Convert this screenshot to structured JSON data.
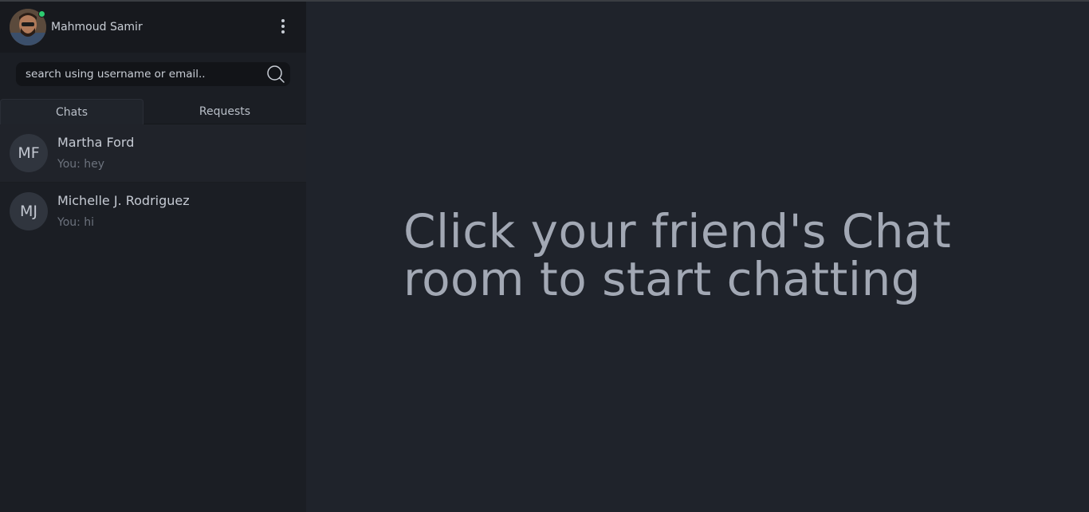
{
  "user": {
    "name": "Mahmoud Samir",
    "status": "online"
  },
  "search": {
    "placeholder": "search using username or email..",
    "value": ""
  },
  "tabs": [
    {
      "label": "Chats",
      "active": true
    },
    {
      "label": "Requests",
      "active": false
    }
  ],
  "chats": [
    {
      "initials": "MF",
      "name": "Martha Ford",
      "preview": "You: hey"
    },
    {
      "initials": "MJ",
      "name": "Michelle J. Rodriguez",
      "preview": "You: hi"
    }
  ],
  "main": {
    "placeholder_line1": "Click your friend's Chat",
    "placeholder_line2": "room to start chatting"
  },
  "colors": {
    "sidebar_bg": "#1b1e24",
    "main_bg": "#1f232b",
    "online": "#2ecc71"
  }
}
